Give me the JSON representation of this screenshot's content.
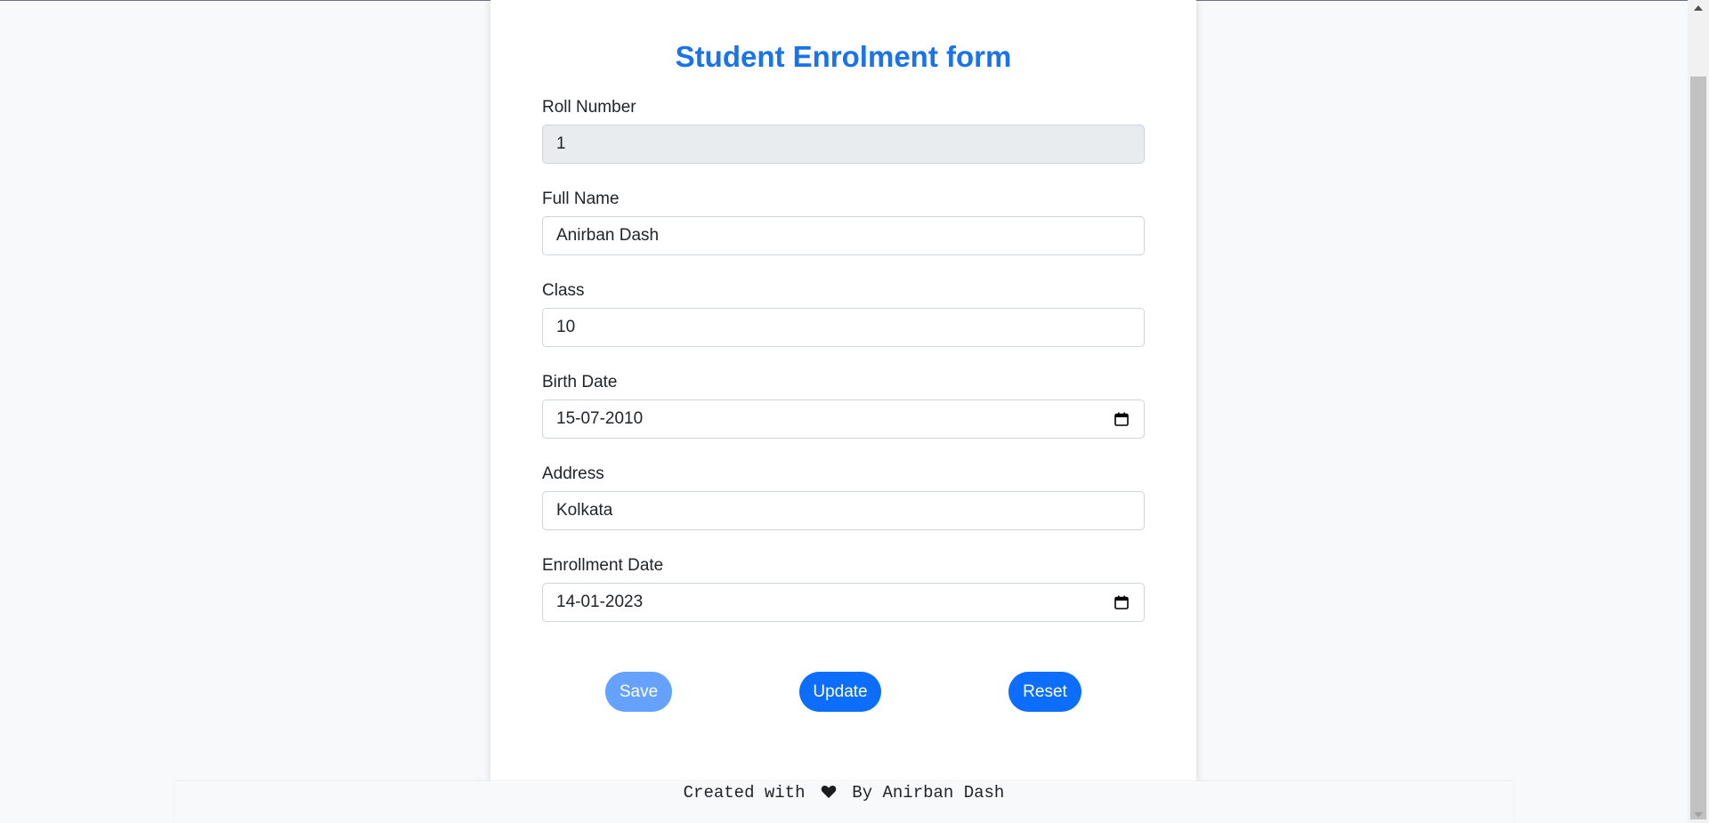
{
  "form": {
    "title": "Student Enrolment form",
    "fields": [
      {
        "label": "Roll Number",
        "value": "1",
        "readonly": true
      },
      {
        "label": "Full Name",
        "value": "Anirban Dash"
      },
      {
        "label": "Class",
        "value": "10"
      },
      {
        "label": "Birth Date",
        "value": "15-07-2010",
        "icon": "calendar-icon"
      },
      {
        "label": "Address",
        "value": "Kolkata"
      },
      {
        "label": "Enrollment Date",
        "value": "14-01-2023",
        "icon": "calendar-icon"
      }
    ],
    "buttons": {
      "save": "Save",
      "update": "Update",
      "reset": "Reset"
    }
  },
  "footer": {
    "prefix": "Created with",
    "heart_icon": "heart-icon",
    "suffix": "By Anirban Dash"
  },
  "colors": {
    "accent": "#0d6efd",
    "title": "#1a73e8",
    "disabled_button": "#64a2fd",
    "readonly_bg": "#e9ecef"
  }
}
